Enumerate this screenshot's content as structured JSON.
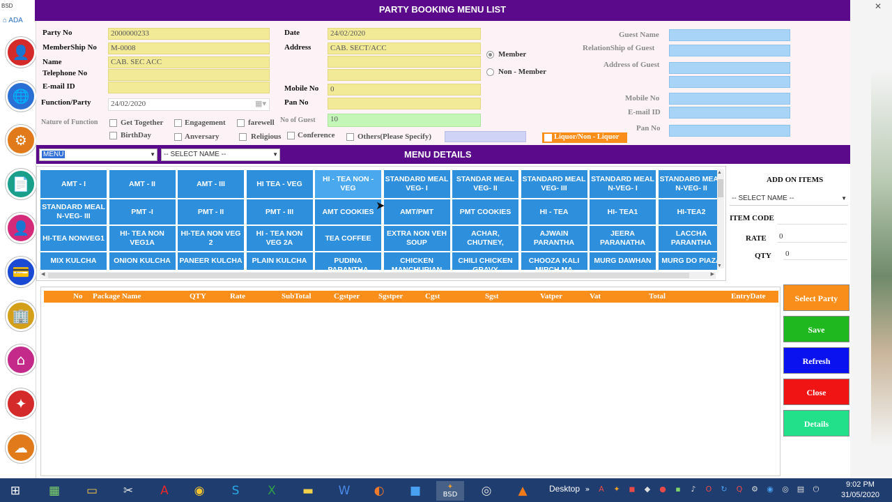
{
  "window": {
    "title": "PARTY BOOKING MENU LIST"
  },
  "rail": {
    "top_text": "BSD",
    "app_label": "ADA",
    "icons": [
      {
        "name": "user-icon",
        "glyph": "👤",
        "color": "#d42a2a"
      },
      {
        "name": "globe-icon",
        "glyph": "🌐",
        "color": "#2a6fd4"
      },
      {
        "name": "gear-icon",
        "glyph": "⚙",
        "color": "#e07a1a"
      },
      {
        "name": "document-icon",
        "glyph": "📄",
        "color": "#1aa08a"
      },
      {
        "name": "profile-icon",
        "glyph": "👤",
        "color": "#d42a7a"
      },
      {
        "name": "card-icon",
        "glyph": "💳",
        "color": "#1a4ad4"
      },
      {
        "name": "building-icon",
        "glyph": "🏢",
        "color": "#d4a01a"
      },
      {
        "name": "home-icon",
        "glyph": "⌂",
        "color": "#c42a8a"
      },
      {
        "name": "sparkle-icon",
        "glyph": "✦",
        "color": "#d42a2a"
      },
      {
        "name": "cloud-icon",
        "glyph": "☁",
        "color": "#e07a1a"
      }
    ]
  },
  "form": {
    "party_no": {
      "label": "Party No",
      "value": "2000000233"
    },
    "membership_no": {
      "label": "MemberShip No",
      "value": "M-0008"
    },
    "name": {
      "label": "Name",
      "value": "CAB. SEC ACC"
    },
    "telephone_no": {
      "label": "Telephone No",
      "value": ""
    },
    "email_id": {
      "label": "E-mail ID",
      "value": ""
    },
    "function_party": {
      "label": "Function/Party",
      "value": "24/02/2020"
    },
    "nature_of_function": {
      "label": "Nature of Function"
    },
    "date": {
      "label": "Date",
      "value": "24/02/2020"
    },
    "address": {
      "label": "Address",
      "value": "CAB. SECT/ACC"
    },
    "mobile_no": {
      "label": "Mobile No",
      "value": "0"
    },
    "pan_no": {
      "label": "Pan No",
      "value": ""
    },
    "no_of_guest": {
      "label": "No of Guest",
      "value": "10"
    },
    "member_type": {
      "member": "Member",
      "non_member": "Non - Member"
    },
    "guest": {
      "guest_name": "Guest Name",
      "relationship": "RelationShip of Guest",
      "address": "Address of Guest",
      "mobile_no": "Mobile No",
      "email_id": "E-mail ID",
      "pan_no": "Pan No"
    },
    "functions": {
      "get_together": "Get Together",
      "engagement": "Engagement",
      "farewell": "farewell",
      "birthday": "BirthDay",
      "anniversary": "Anversary",
      "religious": "Religious",
      "conference": "Conference",
      "others": "Others(Please Specify)"
    },
    "liquor": "Liquor/Non - Liquor"
  },
  "menu_bar": {
    "title": "MENU DETAILS",
    "menu_combo": "MENU",
    "name_combo": "-- SELECT NAME --"
  },
  "menu_items": [
    [
      "AMT - I",
      "AMT - II",
      "AMT - III",
      "HI TEA - VEG",
      "HI - TEA NON - VEG",
      "STANDARD MEAL VEG- I",
      "STANDAR MEAL VEG- II",
      "STANDARD MEAL VEG- III",
      "STANDARD MEAL N-VEG- I",
      "STANDARD MEAL N-VEG- II"
    ],
    [
      "STANDARD MEAL N-VEG- III",
      "PMT -I",
      "PMT - II",
      "PMT - III",
      "AMT COOKIES",
      "AMT/PMT",
      "PMT COOKIES",
      "HI - TEA",
      "HI- TEA1",
      "HI-TEA2"
    ],
    [
      "HI-TEA NONVEG1",
      "HI- TEA NON VEG1A",
      "HI-TEA NON VEG 2",
      "HI - TEA NON VEG 2A",
      "TEA COFFEE",
      "EXTRA NON VEH SOUP",
      "ACHAR, CHUTNEY,",
      "AJWAIN PARANTHA",
      "JEERA PARANATHA",
      "LACCHA PARANTHA"
    ],
    [
      "MIX KULCHA",
      "ONION KULCHA",
      "PANEER KULCHA",
      "PLAIN KULCHA",
      "PUDINA PARANTHA",
      "CHICKEN MANCHURIAN",
      "CHILI CHICKEN GRAVY",
      "CHOOZA KALI MIRCH MA",
      "MURG DAWHAN",
      "MURG DO PIAZA"
    ]
  ],
  "addon": {
    "title": "ADD ON ITEMS",
    "select_name": "-- SELECT NAME --",
    "item_code": {
      "label": "ITEM CODE",
      "value": ""
    },
    "rate": {
      "label": "RATE",
      "value": "0"
    },
    "qty": {
      "label": "QTY",
      "value": "0"
    }
  },
  "table": {
    "columns": [
      "No",
      "Package Name",
      "QTY",
      "Rate",
      "SubTotal",
      "Cgstper",
      "Sgstper",
      "Cgst",
      "Sgst",
      "Vatper",
      "Vat",
      "Total",
      "EntryDate"
    ],
    "rows": []
  },
  "buttons": {
    "select_party": {
      "label": "Select Party",
      "color": "#f98e1a"
    },
    "save": {
      "label": "Save",
      "color": "#1fb81f"
    },
    "refresh": {
      "label": "Refresh",
      "color": "#0a12f0"
    },
    "close": {
      "label": "Close",
      "color": "#f01414"
    },
    "details": {
      "label": "Details",
      "color": "#22e08a"
    }
  },
  "taskbar": {
    "desktop_label": "Desktop",
    "time": "9:02 PM",
    "date": "31/05/2020",
    "bsd_label": "BSD"
  }
}
